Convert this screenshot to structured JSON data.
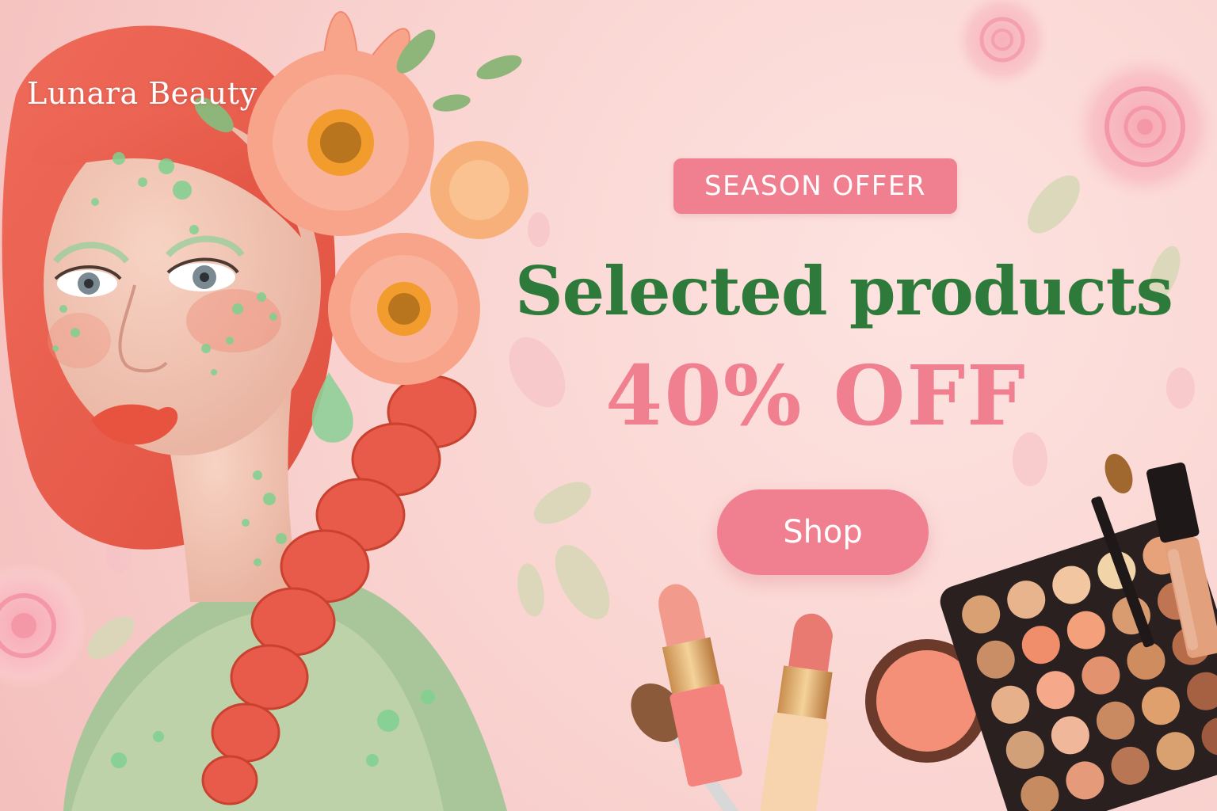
{
  "brand": {
    "name": "Lunara Beauty"
  },
  "promo": {
    "badge": "SEASON OFFER",
    "headline": "Selected products",
    "discount": "40% OFF",
    "cta_label": "Shop"
  },
  "colors": {
    "accent_pink": "#f07f90",
    "headline_green": "#2d7a3a",
    "background_pink": "#f9d2cf"
  },
  "icons": [
    "rose-icon",
    "leaf-icon",
    "flower-icon",
    "lipstick-icon",
    "brush-icon",
    "blush-compact-icon",
    "eyeshadow-palette-icon",
    "lip-gloss-icon"
  ]
}
